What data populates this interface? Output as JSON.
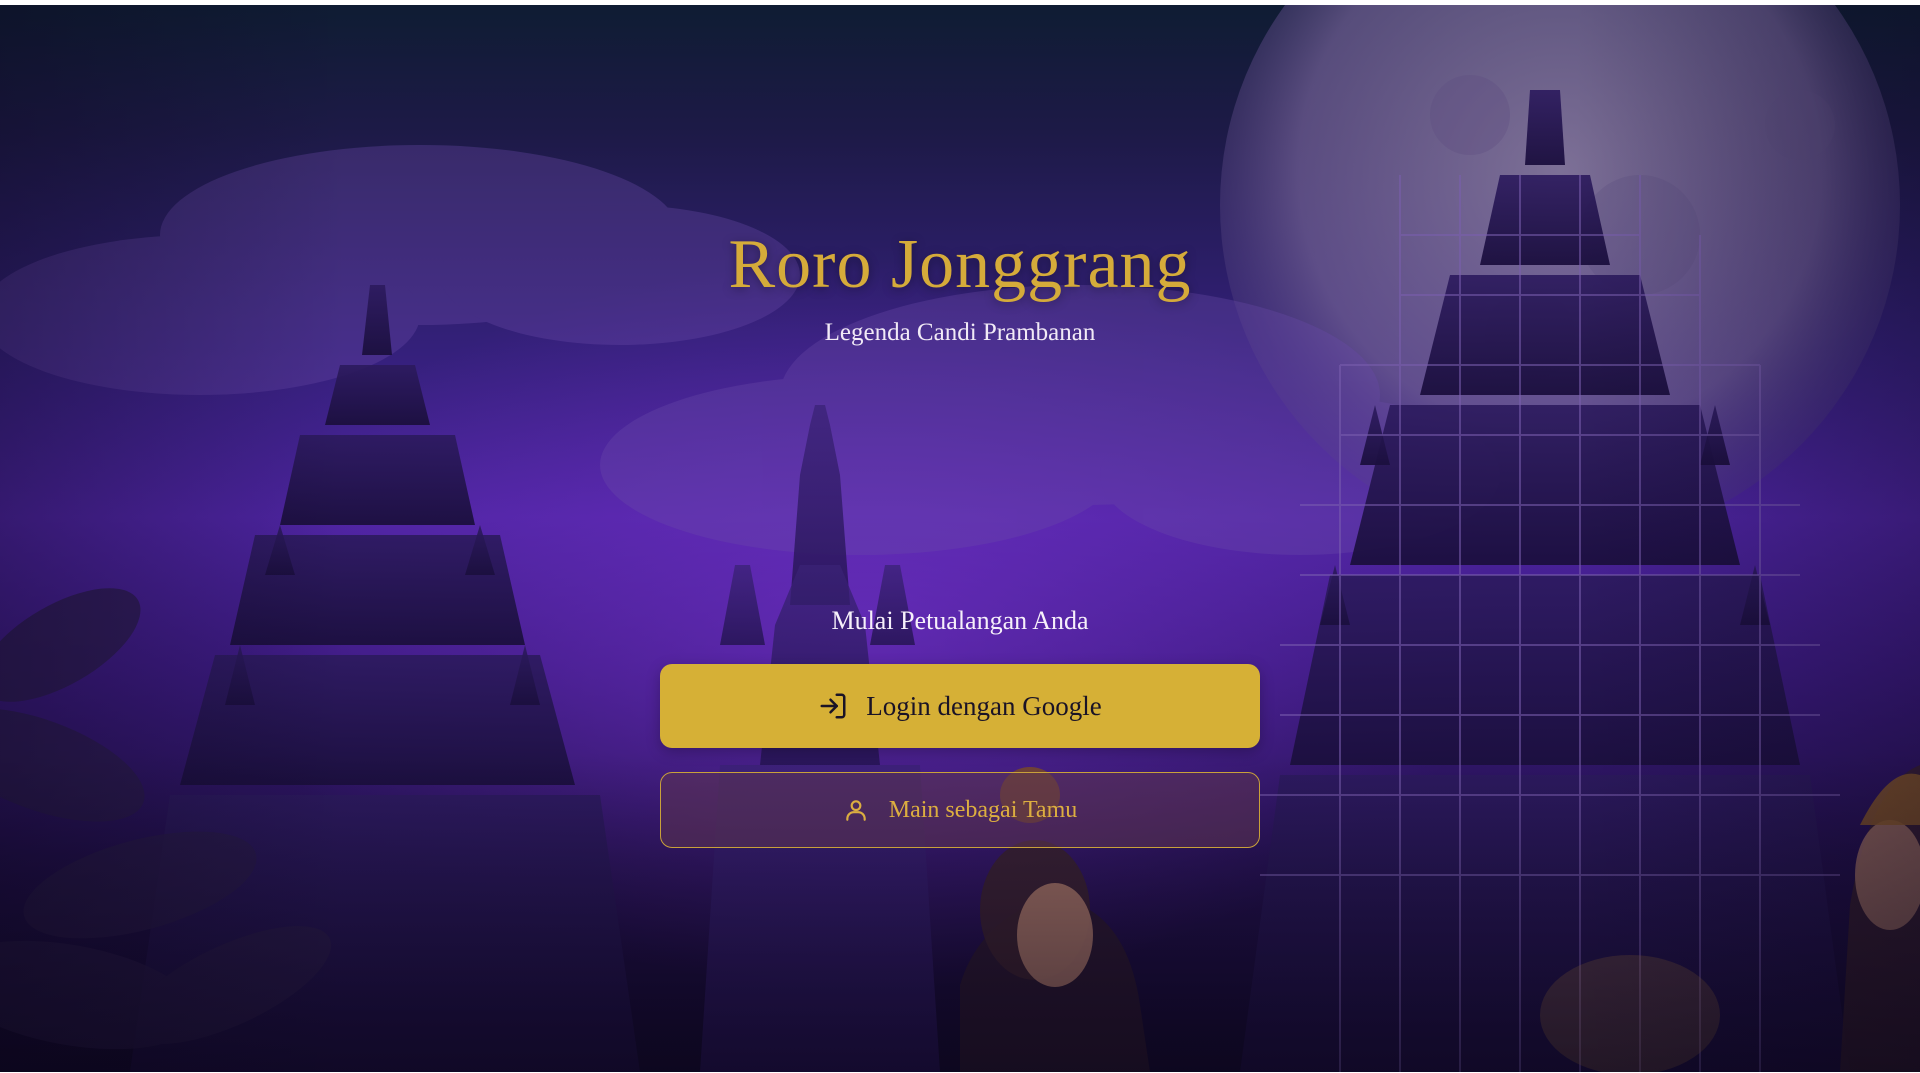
{
  "app": {
    "title": "Roro Jonggrang",
    "subtitle": "Legenda Candi Prambanan"
  },
  "auth": {
    "heading": "Mulai Petualangan Anda",
    "google_label": "Login dengan Google",
    "google_icon": "log-in-arrow-icon",
    "guest_label": "Main sebagai Tamu",
    "guest_icon": "user-icon"
  },
  "colors": {
    "accent_gold": "#d6b036",
    "title_gold": "#d5ab3a",
    "background_purple": "#4d24a0",
    "text_light": "#f1eaf6"
  }
}
